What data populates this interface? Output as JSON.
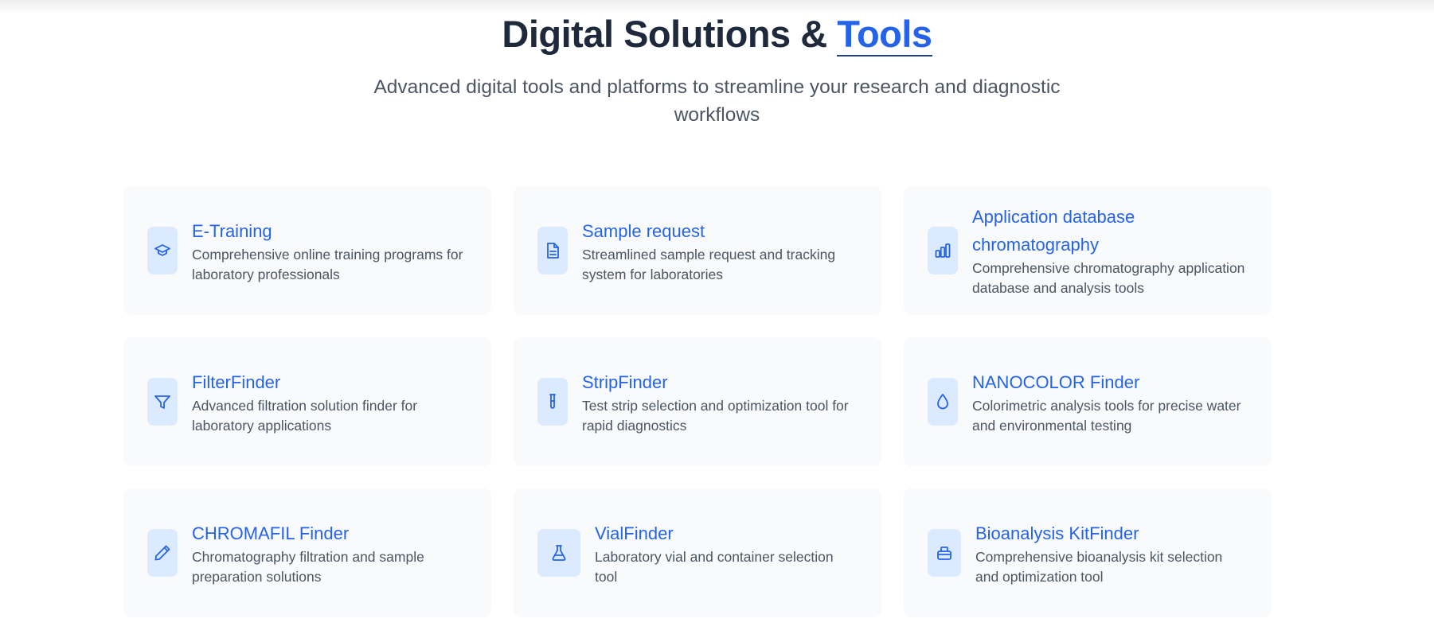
{
  "header": {
    "title_main": "Digital Solutions & ",
    "title_accent": "Tools",
    "subtitle": "Advanced digital tools and platforms to streamline your research and diagnostic workflows"
  },
  "colors": {
    "accent": "#2563eb",
    "heading": "#1e293b",
    "body_text": "#4b5563",
    "card_bg": "#f8fafc",
    "icon_bg": "#dbeafe"
  },
  "cards": [
    {
      "icon": "graduation-cap-icon",
      "title": "E-Training",
      "description": "Comprehensive online training programs for laboratory professionals"
    },
    {
      "icon": "document-icon",
      "title": "Sample request",
      "description": "Streamlined sample request and tracking system for laboratories"
    },
    {
      "icon": "bar-chart-icon",
      "title": "Application database chromatography",
      "description": "Comprehensive chromatography application database and analysis tools"
    },
    {
      "icon": "filter-icon",
      "title": "FilterFinder",
      "description": "Advanced filtration solution finder for laboratory applications"
    },
    {
      "icon": "test-tube-icon",
      "title": "StripFinder",
      "description": "Test strip selection and optimization tool for rapid diagnostics"
    },
    {
      "icon": "droplet-icon",
      "title": "NANOCOLOR Finder",
      "description": "Colorimetric analysis tools for precise water and environmental testing"
    },
    {
      "icon": "pencil-icon",
      "title": "CHROMAFIL Finder",
      "description": "Chromatography filtration and sample preparation solutions"
    },
    {
      "icon": "flask-icon",
      "title": "VialFinder",
      "description": "Laboratory vial and container selection tool"
    },
    {
      "icon": "kit-box-icon",
      "title": "Bioanalysis KitFinder",
      "description": "Comprehensive bioanalysis kit selection and optimization tool"
    }
  ]
}
